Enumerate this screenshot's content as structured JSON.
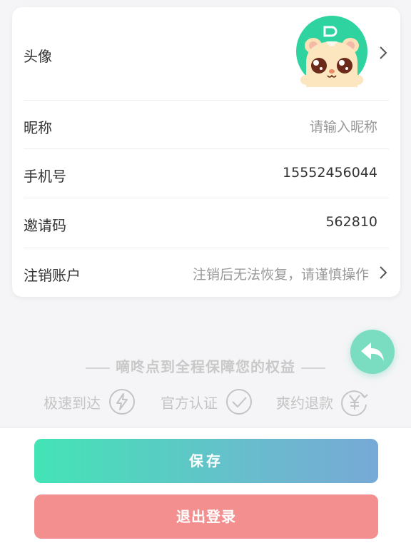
{
  "profile": {
    "avatar_label": "头像",
    "nickname_label": "昵称",
    "nickname_placeholder": "请输入昵称",
    "phone_label": "手机号",
    "phone_value": "15552456044",
    "invite_label": "邀请码",
    "invite_value": "562810",
    "cancel_label": "注销账户",
    "cancel_hint": "注销后无法恢复，请谨慎操作"
  },
  "slogan": "嘀咚点到全程保障您的权益",
  "features": [
    {
      "label": "极速到达",
      "icon": "lightning-icon"
    },
    {
      "label": "官方认证",
      "icon": "checkmark-circle-icon"
    },
    {
      "label": "爽约退款",
      "icon": "yen-refund-icon"
    }
  ],
  "buttons": {
    "save": "保存",
    "logout": "退出登录"
  },
  "colors": {
    "accent_green": "#43e4b6",
    "accent_blue": "#77a9d6",
    "logout_red": "#f38f8f",
    "fab": "#7adcc0"
  }
}
